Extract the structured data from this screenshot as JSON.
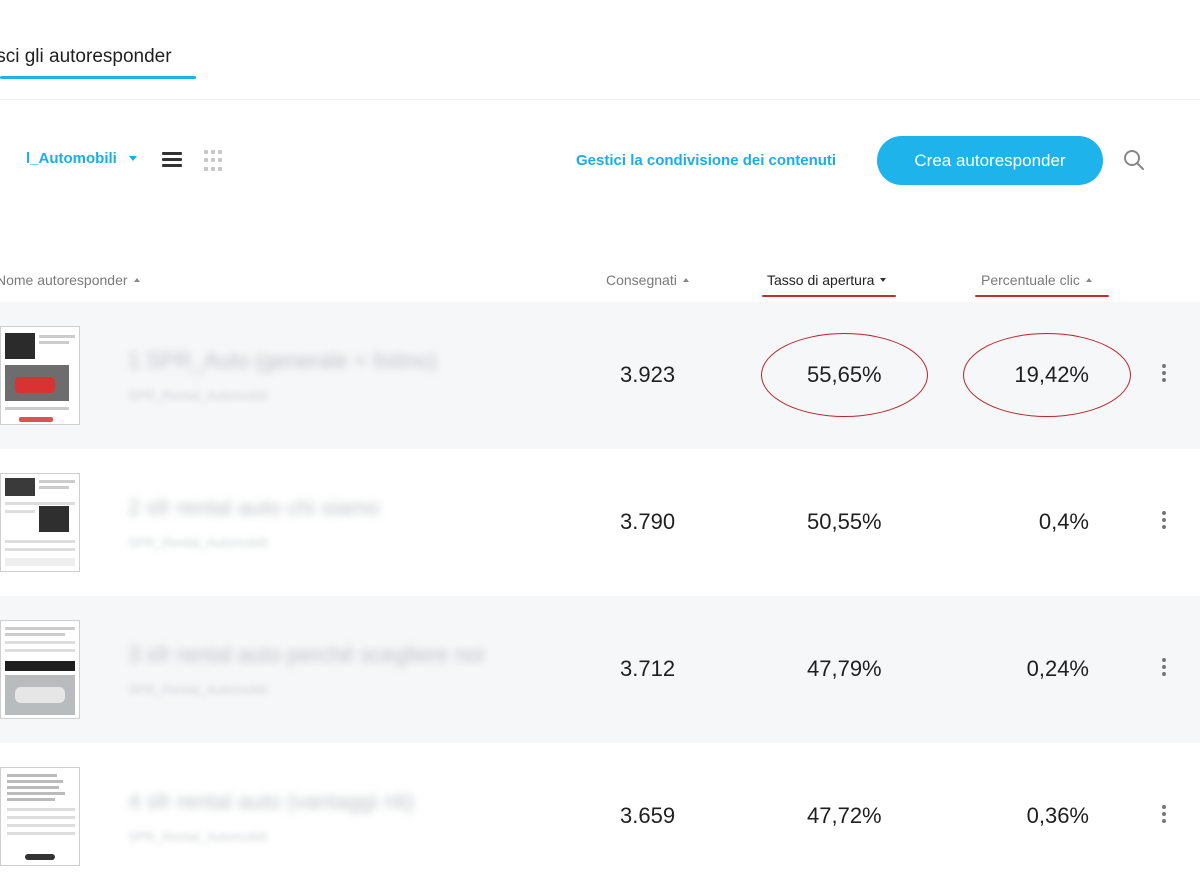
{
  "tab": {
    "label": "isci gli autoresponder"
  },
  "toolbar": {
    "list_label": "l_Automobili",
    "share_label": "Gestici la condivisione dei contenuti",
    "create_label": "Crea autoresponder"
  },
  "columns": {
    "name": "Nome autoresponder",
    "delivered": "Consegnati",
    "open_rate": "Tasso di apertura",
    "click_rate": "Percentuale clic"
  },
  "rows": [
    {
      "name": "1 SPR_Auto (generale + listino)",
      "list": "SPR_Rental_Automobili",
      "delivered": "3.923",
      "open_rate": "55,65%",
      "click_rate": "19,42%"
    },
    {
      "name": "2 sfr rental auto chi siamo",
      "list": "SPR_Rental_Automobili",
      "delivered": "3.790",
      "open_rate": "50,55%",
      "click_rate": "0,4%"
    },
    {
      "name": "3 sfr rental auto perché scegliere noi",
      "list": "SPR_Rental_Automobili",
      "delivered": "3.712",
      "open_rate": "47,79%",
      "click_rate": "0,24%"
    },
    {
      "name": "4 sfr rental auto (vantaggi nlt)",
      "list": "SPR_Rental_Automobili",
      "delivered": "3.659",
      "open_rate": "47,72%",
      "click_rate": "0,36%"
    }
  ],
  "colors": {
    "accent": "#1eb3ea",
    "annotation": "#c62d2d"
  }
}
